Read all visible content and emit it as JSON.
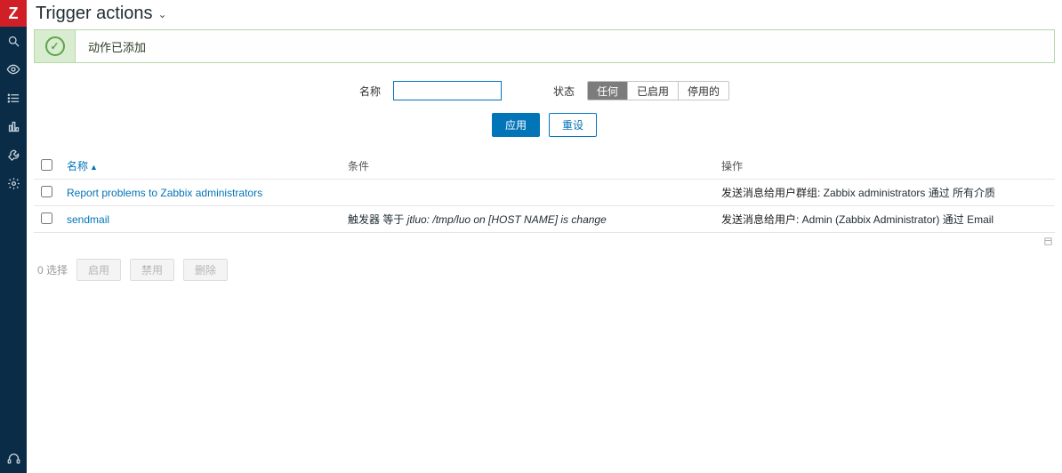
{
  "sidebar": {
    "logo_letter": "Z"
  },
  "header": {
    "page_title": "Trigger actions"
  },
  "success": {
    "message": "动作已添加"
  },
  "filter": {
    "name_label": "名称",
    "name_value": "",
    "status_label": "状态",
    "status_options": [
      "任何",
      "已启用",
      "停用的"
    ],
    "apply": "应用",
    "reset": "重设"
  },
  "table": {
    "headers": {
      "name": "名称",
      "conditions": "条件",
      "operations": "操作"
    },
    "rows": [
      {
        "name": "Report problems to Zabbix administrators",
        "conditions": "",
        "op_prefix": "发送消息给用户群组:",
        "op_rest": " Zabbix administrators 通过 所有介质"
      },
      {
        "name": "sendmail",
        "conditions_prefix": "触发器 等于 ",
        "conditions_italic": "jtluo: /tmp/luo on [HOST NAME] is change",
        "op_prefix": "发送消息给用户:",
        "op_rest": " Admin (Zabbix Administrator) 通过 Email"
      }
    ]
  },
  "bulk": {
    "selected": "0 选择",
    "enable": "启用",
    "disable": "禁用",
    "delete": "删除"
  }
}
